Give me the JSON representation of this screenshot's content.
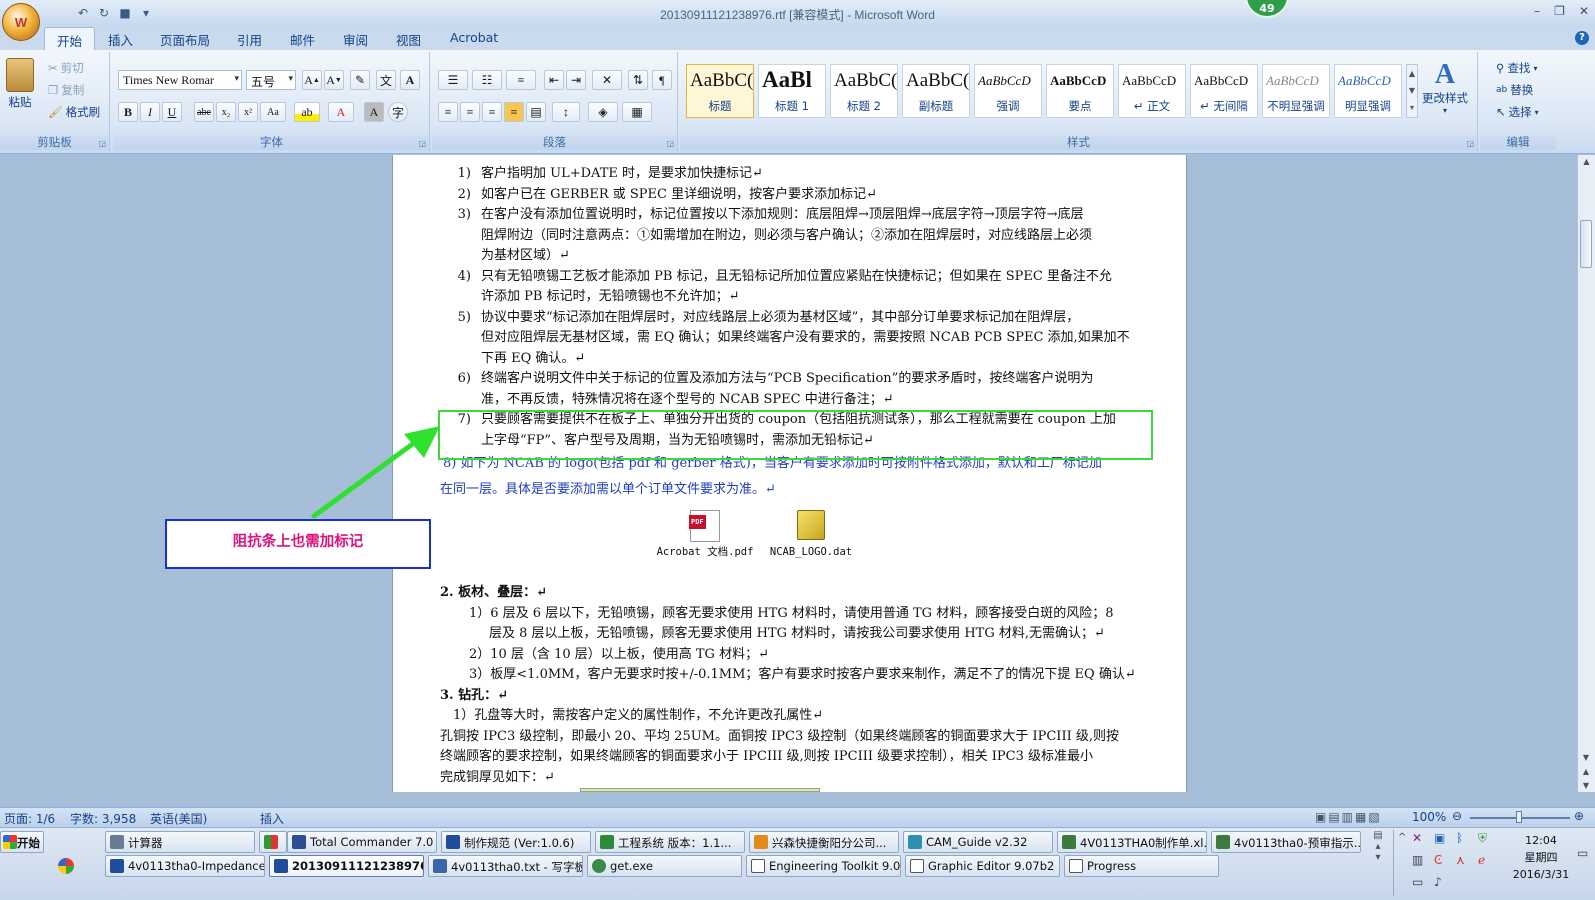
{
  "window": {
    "title": "20130911121238976.rtf [兼容模式] - Microsoft Word",
    "notification_count": "49"
  },
  "tabs": [
    "开始",
    "插入",
    "页面布局",
    "引用",
    "邮件",
    "审阅",
    "视图",
    "Acrobat"
  ],
  "ribbon": {
    "clipboard": {
      "paste": "粘贴",
      "cut": "剪切",
      "copy": "复制",
      "format_painter": "格式刷",
      "label": "剪贴板"
    },
    "font": {
      "name": "Times New Romar",
      "size": "五号",
      "label": "字体"
    },
    "paragraph": {
      "label": "段落"
    },
    "styles": {
      "label": "样式",
      "change_styles": "更改样式",
      "items": [
        {
          "sample": "AaBbC(",
          "name": "标题"
        },
        {
          "sample": "AaBl",
          "name": "标题 1"
        },
        {
          "sample": "AaBbC(",
          "name": "标题 2"
        },
        {
          "sample": "AaBbC(",
          "name": "副标题"
        },
        {
          "sample": "AaBbCcD",
          "name": "强调"
        },
        {
          "sample": "AaBbCcD",
          "name": "要点"
        },
        {
          "sample": "AaBbCcD",
          "name": "↵ 正文"
        },
        {
          "sample": "AaBbCcD",
          "name": "↵ 无间隔"
        },
        {
          "sample": "AaBbCcD",
          "name": "不明显强调"
        },
        {
          "sample": "AaBbCcD",
          "name": "明显强调"
        }
      ]
    },
    "editing": {
      "find": "查找",
      "replace": "替换",
      "select": "选择",
      "label": "编辑"
    }
  },
  "document": {
    "lines": [
      {
        "num": "1)",
        "text": "客户指明加 UL+DATE 时，是要求加快捷标记↵"
      },
      {
        "num": "2)",
        "text": "如客户已在 GERBER 或 SPEC 里详细说明，按客户要求添加标记↵"
      },
      {
        "num": "3)",
        "text": "在客户没有添加位置说明时，标记位置按以下添加规则：底层阻焊→顶层阻焊→底层字符→顶层字符→底层"
      },
      {
        "num": "",
        "text": "阻焊附边（同时注意两点：①如需增加在附边，则必须与客户确认；②添加在阻焊层时，对应线路层上必须"
      },
      {
        "num": "",
        "text": "为基材区域）↵"
      },
      {
        "num": "4)",
        "text": "只有无铅喷锡工艺板才能添加 PB 标记，且无铅标记所加位置应紧贴在快捷标记；但如果在 SPEC 里备注不允"
      },
      {
        "num": "",
        "text": "许添加 PB 标记时，无铅喷锡也不允许加；↵"
      },
      {
        "num": "5)",
        "text": "协议中要求“标记添加在阻焊层时，对应线路层上必须为基材区域”，其中部分订单要求标记加在阻焊层，"
      },
      {
        "num": "",
        "text": "但对应阻焊层无基材区域，需 EQ 确认；如果终端客户没有要求的，需要按照 NCAB PCB SPEC 添加,如果加不"
      },
      {
        "num": "",
        "text": "下再 EQ 确认。↵"
      },
      {
        "num": "6)",
        "text": "终端客户说明文件中关于标记的位置及添加方法与“PCB Specification”的要求矛盾时，按终端客户说明为"
      },
      {
        "num": "",
        "text": "准，不再反馈，特殊情况将在逐个型号的 NCAB SPEC 中进行备注；↵"
      },
      {
        "num": "7)",
        "text": "只要顾客需要提供不在板子上、单独分开出货的 coupon（包括阻抗测试条），那么工程就需要在 coupon 上加"
      },
      {
        "num": "",
        "text": "上字母“FP”、客户型号及周期，当为无铅喷锡时，需添加无铅标记↵"
      }
    ],
    "item8_line1": "8)   如下为 NCAB 的 logo(包括 pdf 和 gerber 格式)，当客户有要求添加时可按附件格式添加，默认和工厂标记加",
    "item8_line2": "在同一层。具体是否要添加需以单个订单文件要求为准。↵",
    "attachments": [
      "Acrobat 文档.pdf",
      "NCAB_LOGO.dat"
    ],
    "section2": {
      "heading": "2.   板材、叠层：↵",
      "lines": [
        "1）6 层及 6 层以下，无铅喷锡，顾客无要求使用 HTG 材料时，请使用普通 TG 材料，顾客接受白斑的风险；8",
        "层及 8 层以上板，无铅喷锡，顾客无要求使用 HTG 材料时，请按我公司要求使用 HTG 材料,无需确认；↵",
        "2）10 层（含 10 层）以上板，使用高 TG 材料；↵",
        "3）板厚<1.0MM，客户无要求时按+/-0.1MM；客户有要求时按客户要求来制作，满足不了的情况下提 EQ 确认↵"
      ]
    },
    "section3": {
      "heading": "3.   钻孔：↵",
      "lines": [
        "1）孔盘等大时，需按客户定义的属性制作，不允许更改孔属性↵",
        "孔铜按 IPC3 级控制，即最小 20、平均 25UM。面铜按 IPC3 级控制（如果终端顾客的铜面要求大于 IPCIII 级,则按",
        "终端顾客的要求控制，如果终端顾客的铜面要求小于 IPCIII 级,则按 IPCIII 级要求控制），相关 IPC3 级标准最小",
        "完成铜厚见如下：↵"
      ]
    }
  },
  "annotation": {
    "text": "阻抗条上也需加标记"
  },
  "status_bar": {
    "page": "页面: 1/6",
    "words": "字数: 3,958",
    "language": "英语(美国)",
    "mode": "插入",
    "zoom": "100%"
  },
  "taskbar": {
    "start": "开始",
    "row1": [
      "计算器",
      "",
      "Total Commander 7.0 ...",
      "制作规范 (Ver:1.0.6)",
      "工程系统  版本：1.1...",
      "兴森快捷衡阳分公司...",
      "CAM_Guide v2.32",
      "4V0113THA0制作单.xl...",
      "4v0113tha0-预审指示..."
    ],
    "row2": [
      "4v0113tha0-Impedance ...",
      "20130911121238976....",
      "4v0113tha0.txt - 写字板",
      "get.exe",
      "Engineering Toolkit 9.07...",
      "Graphic Editor 9.07b2 (0...",
      "Progress"
    ],
    "clock": {
      "time": "12:04",
      "weekday": "星期四",
      "date": "2016/3/31"
    }
  }
}
